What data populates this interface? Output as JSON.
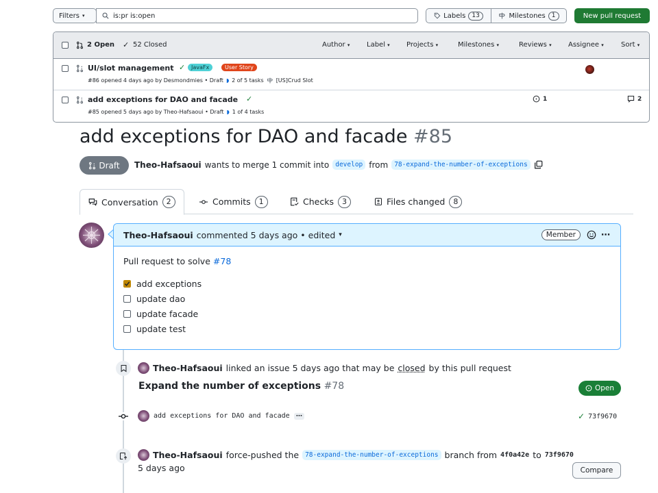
{
  "filter_bar": {
    "filters_label": "Filters",
    "search_value": "is:pr is:open",
    "labels_label": "Labels",
    "labels_count": "13",
    "milestones_label": "Milestones",
    "milestones_count": "1",
    "new_pr_label": "New pull request"
  },
  "list_header": {
    "open_label": "2 Open",
    "closed_label": "52 Closed",
    "filters": [
      "Author",
      "Label",
      "Projects",
      "Milestones",
      "Reviews",
      "Assignee",
      "Sort"
    ]
  },
  "pr_list": [
    {
      "title": "UI/slot management",
      "labels": [
        {
          "text": "JavaFx",
          "bg": "#4fd1d6",
          "fg": "#0b3b3d"
        },
        {
          "text": "User Story",
          "bg": "#e0451b",
          "fg": "#ffffff"
        }
      ],
      "meta": "#86 opened 4 days ago by Desmondmies • Draft",
      "tasks": "2 of 5 tasks",
      "milestone": "[US]Crud Slot",
      "issues_count": "",
      "comments_count": ""
    },
    {
      "title": "add exceptions for DAO and facade",
      "labels": [],
      "meta": "#85 opened 5 days ago by Theo-Hafsaoui • Draft",
      "tasks": "1 of 4 tasks",
      "milestone": "",
      "issues_count": "1",
      "comments_count": "2"
    }
  ],
  "pr": {
    "title": "add exceptions for DAO and facade",
    "number": "#85",
    "state": "Draft",
    "author": "Theo-Hafsaoui",
    "merge_text_1": "wants to merge 1 commit into",
    "base_branch": "develop",
    "merge_text_2": "from",
    "head_branch": "78-expand-the-number-of-exceptions"
  },
  "tabs": [
    {
      "label": "Conversation",
      "count": "2"
    },
    {
      "label": "Commits",
      "count": "1"
    },
    {
      "label": "Checks",
      "count": "3"
    },
    {
      "label": "Files changed",
      "count": "8"
    }
  ],
  "comment": {
    "author": "Theo-Hafsaoui",
    "action": "commented 5 days ago • edited",
    "role": "Member",
    "body_text": "Pull request to solve",
    "body_link": "#78",
    "tasks": [
      {
        "text": "add exceptions",
        "checked": true
      },
      {
        "text": "update dao",
        "checked": false
      },
      {
        "text": "update facade",
        "checked": false
      },
      {
        "text": "update test",
        "checked": false
      }
    ]
  },
  "timeline": {
    "linked": {
      "author": "Theo-Hafsaoui",
      "text_1": "linked an issue 5 days ago that may be",
      "text_closed": "closed",
      "text_2": "by this pull request",
      "issue_title": "Expand the number of exceptions",
      "issue_number": "#78",
      "issue_state": "Open"
    },
    "commit": {
      "message": "add exceptions for DAO and facade",
      "sha": "73f9670"
    },
    "force_push": {
      "author": "Theo-Hafsaoui",
      "text_1": "force-pushed the",
      "branch": "78-expand-the-number-of-exceptions",
      "text_2": "branch from",
      "from_sha": "4f0a42e",
      "text_3": "to",
      "to_sha": "73f9670",
      "time": "5 days ago",
      "compare_label": "Compare"
    }
  },
  "colors": {
    "accent": "#0969da",
    "success": "#1a7f37",
    "draft": "#6e7781",
    "comment_border": "#54aeff",
    "comment_header_bg": "#ddf4ff"
  }
}
